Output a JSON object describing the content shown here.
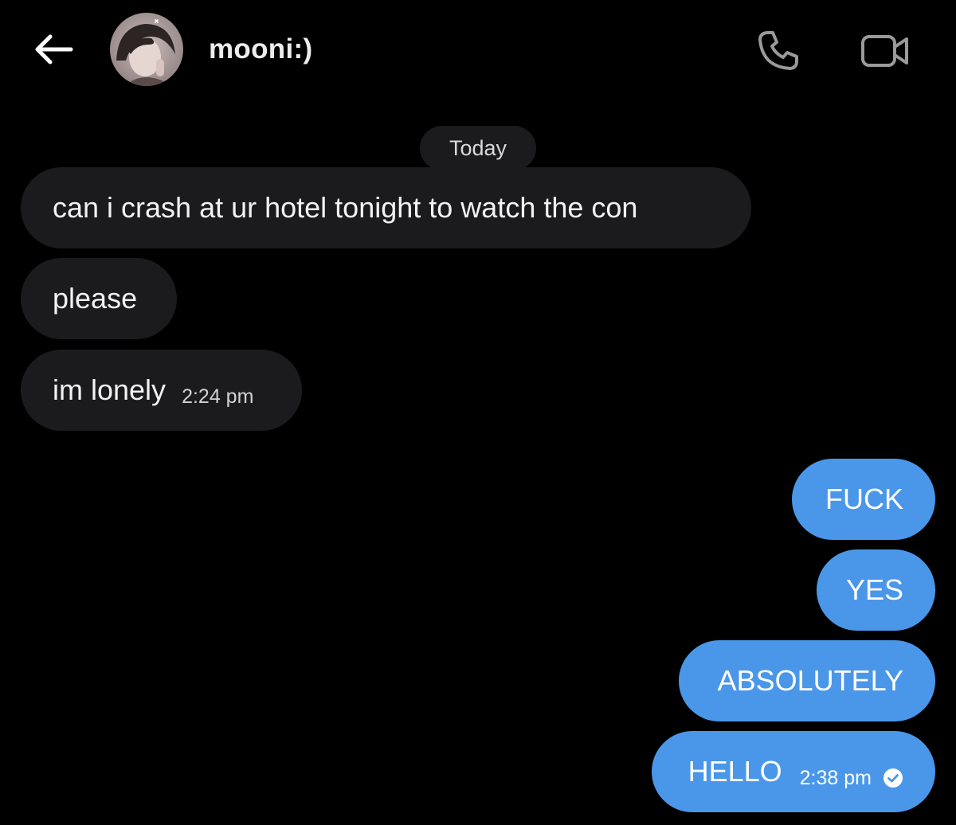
{
  "header": {
    "contact_name": "mooni:)",
    "back_icon": "arrow-left-icon",
    "call_icon": "phone-icon",
    "video_icon": "video-camera-icon"
  },
  "conversation": {
    "date_separator": "Today",
    "incoming": [
      {
        "text": "can i crash at ur hotel tonight to watch the con",
        "time": ""
      },
      {
        "text": "please",
        "time": ""
      },
      {
        "text": "im lonely",
        "time": "2:24 pm"
      }
    ],
    "outgoing": [
      {
        "text": "FUCK",
        "time": ""
      },
      {
        "text": "YES",
        "time": ""
      },
      {
        "text": "ABSOLUTELY",
        "time": ""
      },
      {
        "text": "HELLO",
        "time": "2:38 pm",
        "status_icon": "check-circle-icon"
      }
    ]
  },
  "colors": {
    "background": "#000000",
    "incoming_bubble": "#1b1b1d",
    "outgoing_bubble": "#4a97e9",
    "icon_gray": "#9a9a9a"
  }
}
